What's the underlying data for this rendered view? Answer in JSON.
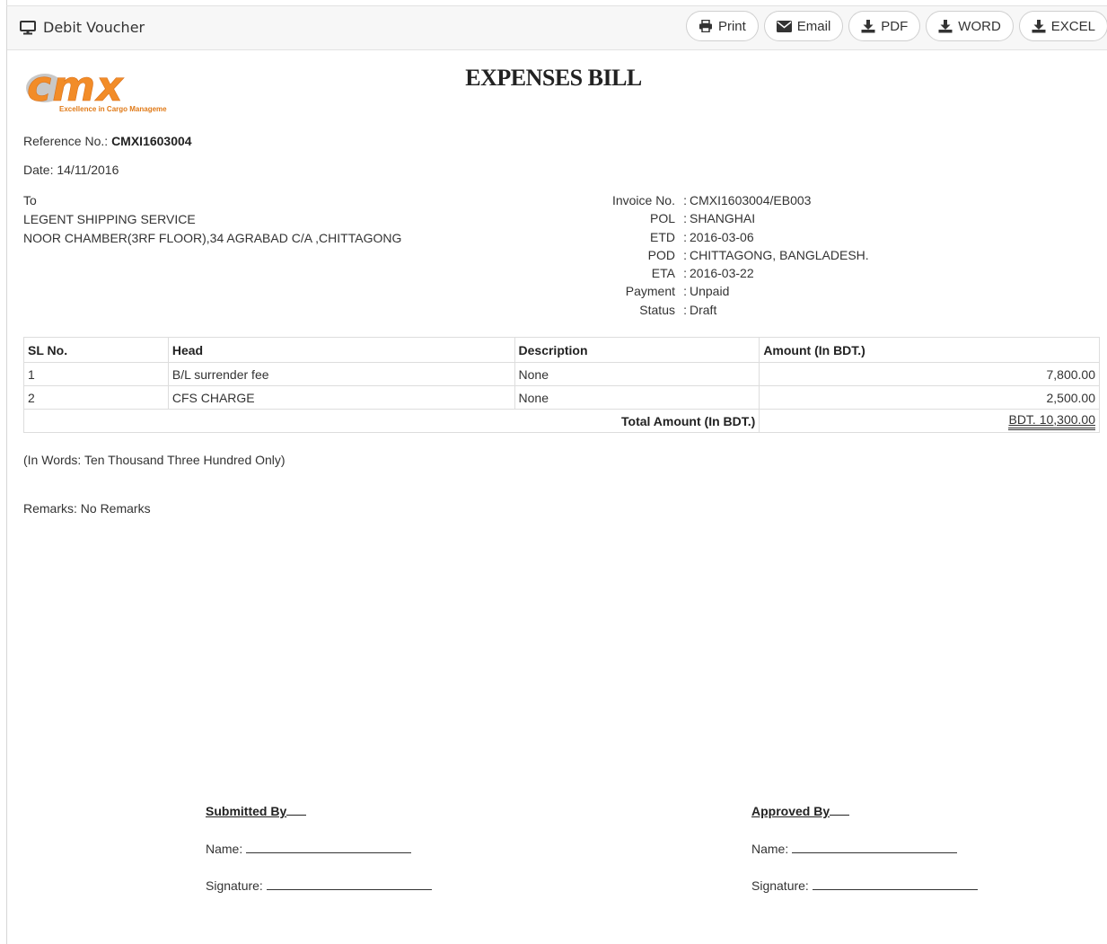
{
  "header": {
    "title": "Debit Voucher",
    "icon": "monitor-icon"
  },
  "toolbar": {
    "print": "Print",
    "email": "Email",
    "pdf": "PDF",
    "word": "WORD",
    "excel": "EXCEL"
  },
  "logo": {
    "text": "cmx",
    "tagline": "Excellence in Cargo Management",
    "brand_color": "#f28c28",
    "shadow_color": "#9a9a9a"
  },
  "document": {
    "title": "EXPENSES BILL",
    "reference_label": "Reference No.:",
    "reference_value": "CMXI1603004",
    "date": "Date: 14/11/2016",
    "to_label": "To",
    "to_name": "LEGENT SHIPPING SERVICE",
    "to_address": "NOOR CHAMBER(3RF FLOOR),34 AGRABAD C/A ,CHITTAGONG"
  },
  "meta": [
    {
      "label": "Invoice No.",
      "value": "CMXI1603004/EB003"
    },
    {
      "label": "POL",
      "value": "SHANGHAI"
    },
    {
      "label": "ETD",
      "value": "2016-03-06"
    },
    {
      "label": "POD",
      "value": "CHITTAGONG, BANGLADESH."
    },
    {
      "label": "ETA",
      "value": "2016-03-22"
    },
    {
      "label": "Payment",
      "value": "Unpaid"
    },
    {
      "label": "Status",
      "value": "Draft"
    }
  ],
  "table": {
    "headers": [
      "SL No.",
      "Head",
      "Description",
      "Amount (In BDT.)"
    ],
    "rows": [
      {
        "sl": "1",
        "head": "B/L surrender fee",
        "description": "None",
        "amount": "7,800.00"
      },
      {
        "sl": "2",
        "head": "CFS CHARGE",
        "description": "None",
        "amount": "2,500.00"
      }
    ],
    "total_label": "Total Amount (In BDT.)",
    "total_value": "BDT. 10,300.00"
  },
  "in_words": "(In Words: Ten Thousand Three Hundred Only)",
  "remarks": "Remarks: No Remarks",
  "signatures": {
    "submitted": {
      "heading": "Submitted By",
      "name_label": "Name:",
      "signature_label": "Signature:"
    },
    "approved": {
      "heading": "Approved By",
      "name_label": "Name:",
      "signature_label": "Signature:"
    }
  }
}
